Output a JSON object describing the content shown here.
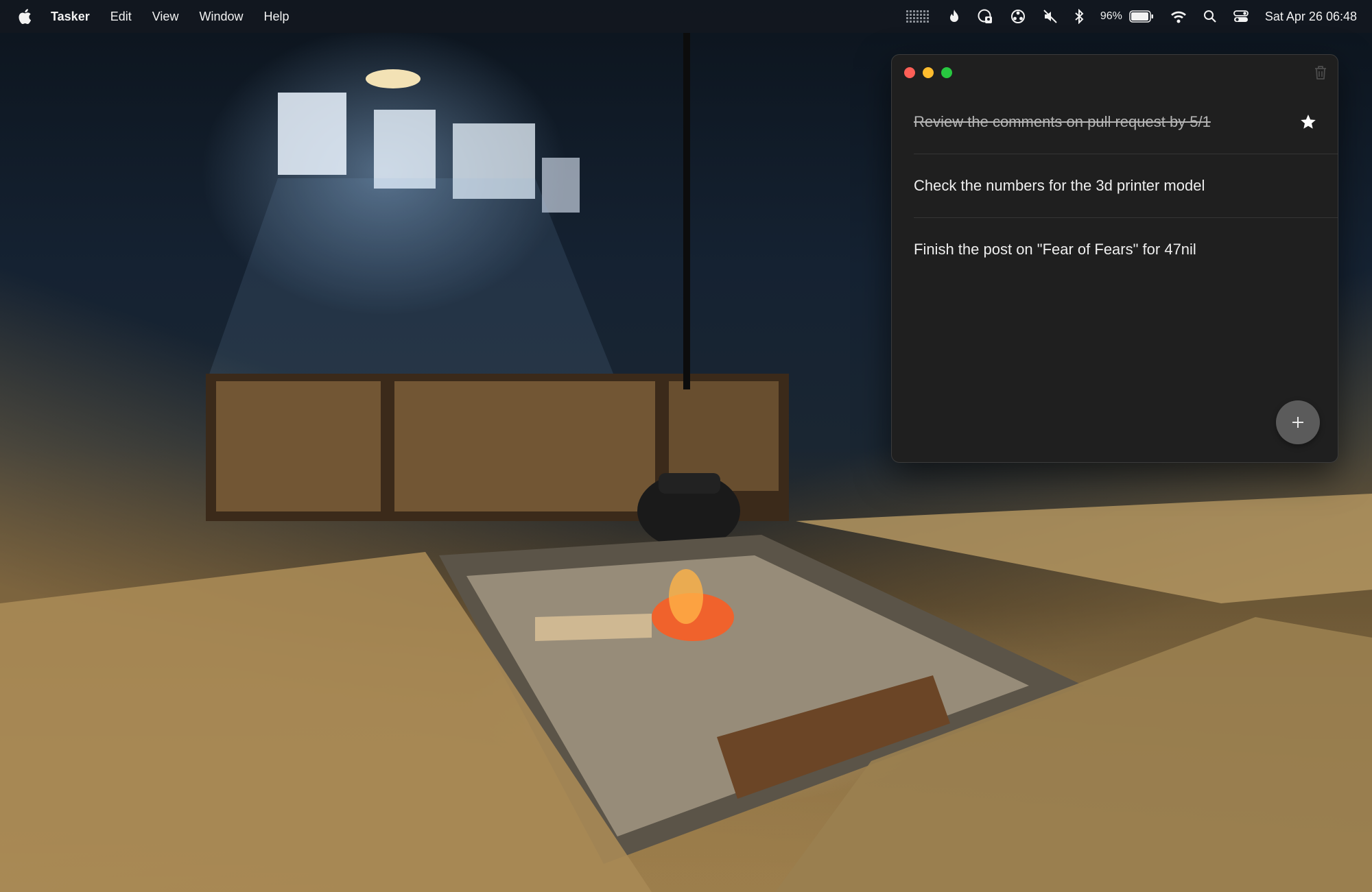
{
  "menubar": {
    "app_name": "Tasker",
    "menus": [
      "Edit",
      "View",
      "Window",
      "Help"
    ],
    "status_icons": [
      "dots-grid-icon",
      "flame-icon",
      "privacy-shield-icon",
      "webhook-icon",
      "muted-speaker-icon",
      "bluetooth-icon",
      "battery-icon",
      "wifi-icon",
      "search-icon",
      "control-center-icon"
    ],
    "battery_percent": "96%",
    "battery_level": 0.96,
    "clock": "Sat Apr 26  06:48"
  },
  "window": {
    "traffic_lights": {
      "close": "#fe5f57",
      "minimize": "#febc2e",
      "zoom": "#28c840"
    },
    "tasks": [
      {
        "text": "Review the comments on pull request by 5/1",
        "completed": true,
        "starred": true
      },
      {
        "text": "Check the numbers for the 3d printer model",
        "completed": false,
        "starred": false
      },
      {
        "text": "Finish the post on \"Fear of Fears\" for 47nil",
        "completed": false,
        "starred": false
      }
    ]
  },
  "colors": {
    "window_bg": "#1f1f1f",
    "menubar_bg": "#121820",
    "add_button_bg": "#5b5b5b"
  }
}
